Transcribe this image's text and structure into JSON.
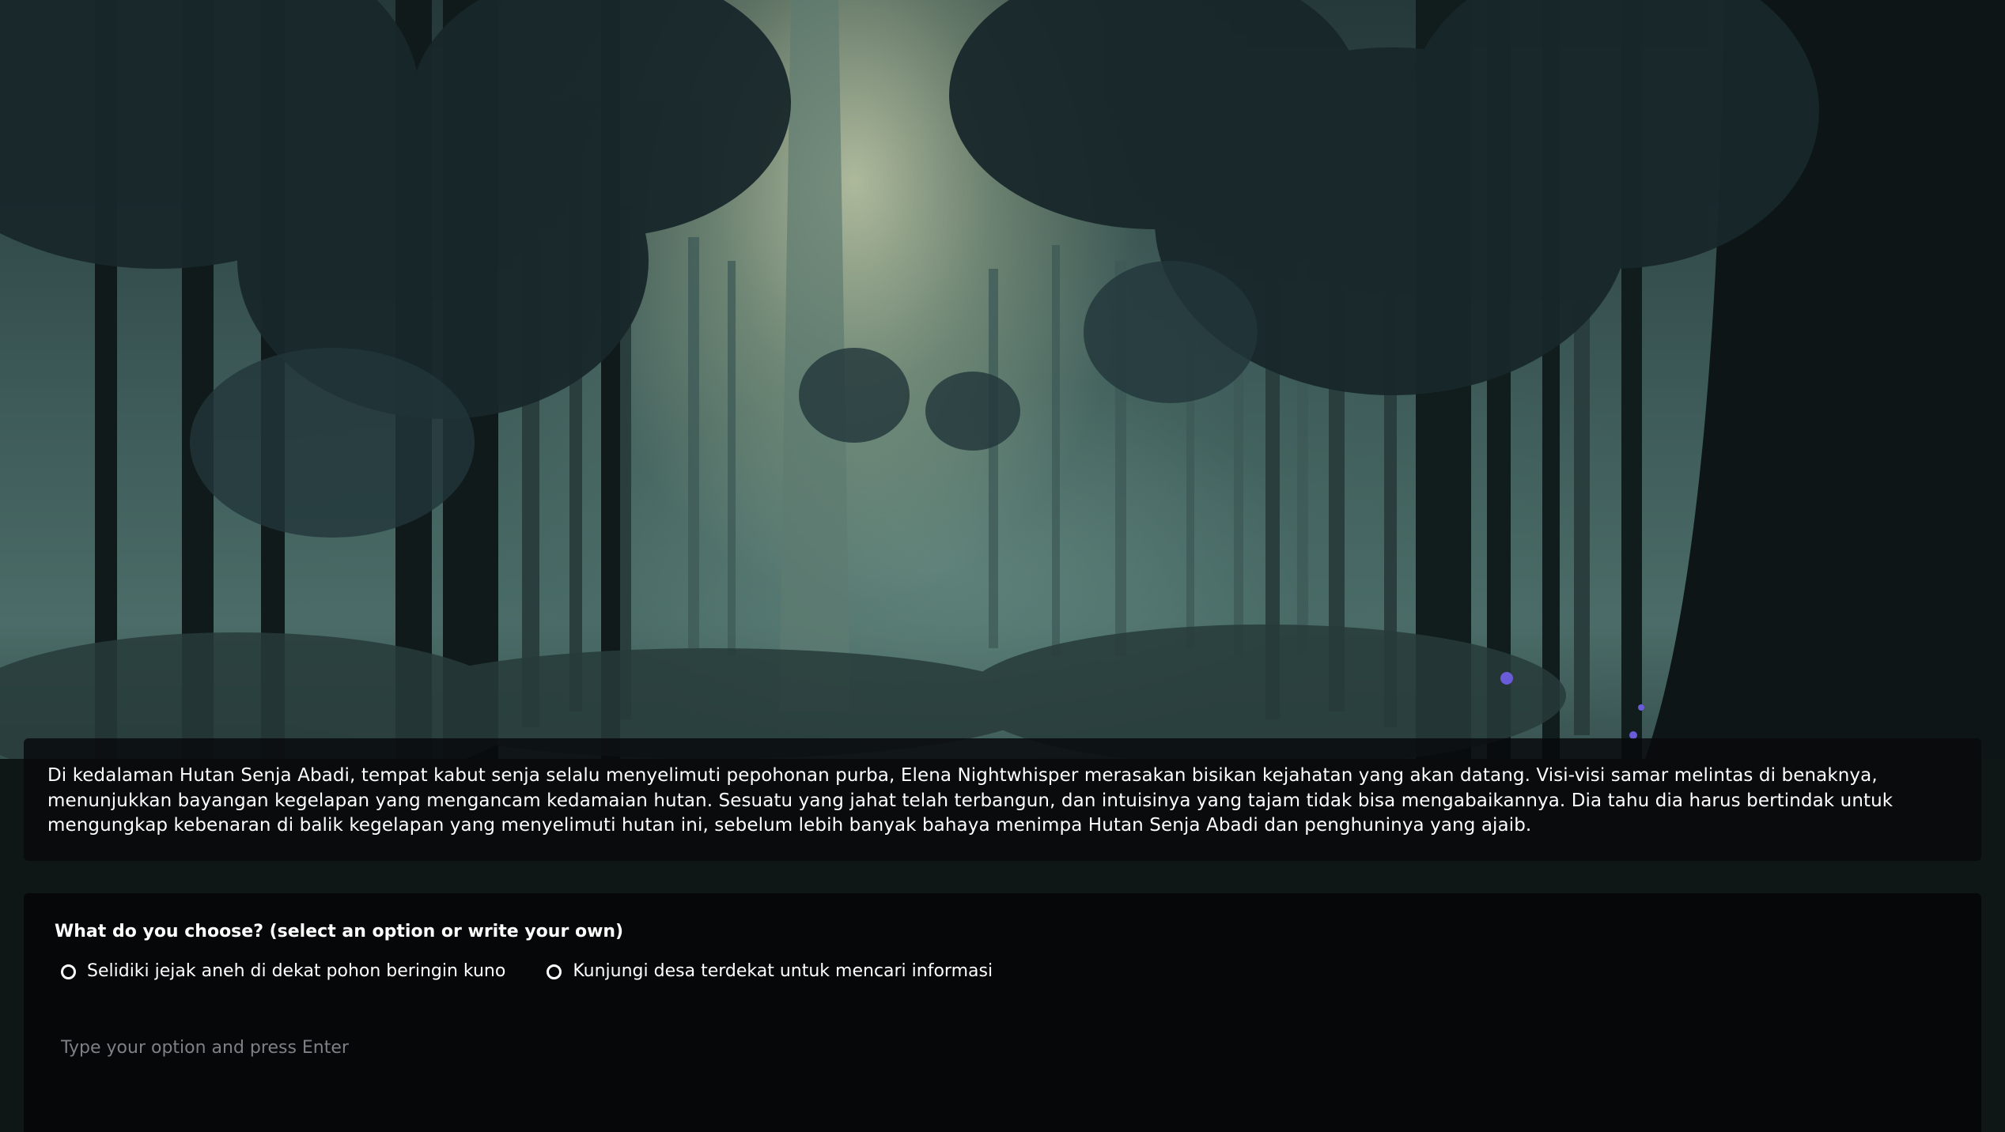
{
  "scene": {
    "background_icon": "misty-forest-illustration"
  },
  "story": {
    "text": "Di kedalaman Hutan Senja Abadi, tempat kabut senja selalu menyelimuti pepohonan purba, Elena Nightwhisper merasakan bisikan kejahatan yang akan datang. Visi-visi samar melintas di benaknya, menunjukkan bayangan kegelapan yang mengancam kedamaian hutan. Sesuatu yang jahat telah terbangun, dan intuisinya yang tajam tidak bisa mengabaikannya. Dia tahu dia harus bertindak untuk mengungkap kebenaran di balik kegelapan yang menyelimuti hutan ini, sebelum lebih banyak bahaya menimpa Hutan Senja Abadi dan penghuninya yang ajaib."
  },
  "choice": {
    "prompt": "What do you choose? (select an option or write your own)",
    "options": [
      {
        "label": "Selidiki jejak aneh di dekat pohon beringin kuno"
      },
      {
        "label": "Kunjungi desa terdekat untuk mencari informasi"
      }
    ],
    "input_placeholder": "Type your option and press Enter",
    "input_value": ""
  },
  "colors": {
    "panel_bg": "#0a0c0e",
    "text": "#ffffff",
    "placeholder": "#7d8184"
  }
}
